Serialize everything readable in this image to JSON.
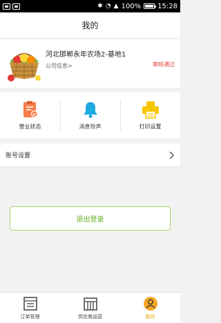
{
  "status_bar": {
    "battery": "100%",
    "time": "15:28"
  },
  "header": {
    "title": "我的"
  },
  "company": {
    "name": "河北邯郸永年农场2-基地1",
    "info_link": "公司信息>",
    "audit_status": "审核通过"
  },
  "actions": [
    {
      "label": "营业状态",
      "icon": "business-status-icon"
    },
    {
      "label": "消息铃声",
      "icon": "bell-icon"
    },
    {
      "label": "打印设置",
      "icon": "printer-icon"
    }
  ],
  "account": {
    "label": "账号设置"
  },
  "logout": {
    "label": "退出登录"
  },
  "tabbar": {
    "items": [
      {
        "label": "订单管理",
        "icon": "order-icon"
      },
      {
        "label": "供应商运营",
        "icon": "supplier-icon"
      },
      {
        "label": "我的",
        "icon": "user-icon"
      }
    ]
  },
  "colors": {
    "accent": "#f5a623",
    "audit": "#e53935",
    "logout": "#5fb023",
    "bell": "#1fa9e1",
    "printer": "#f7c600"
  }
}
